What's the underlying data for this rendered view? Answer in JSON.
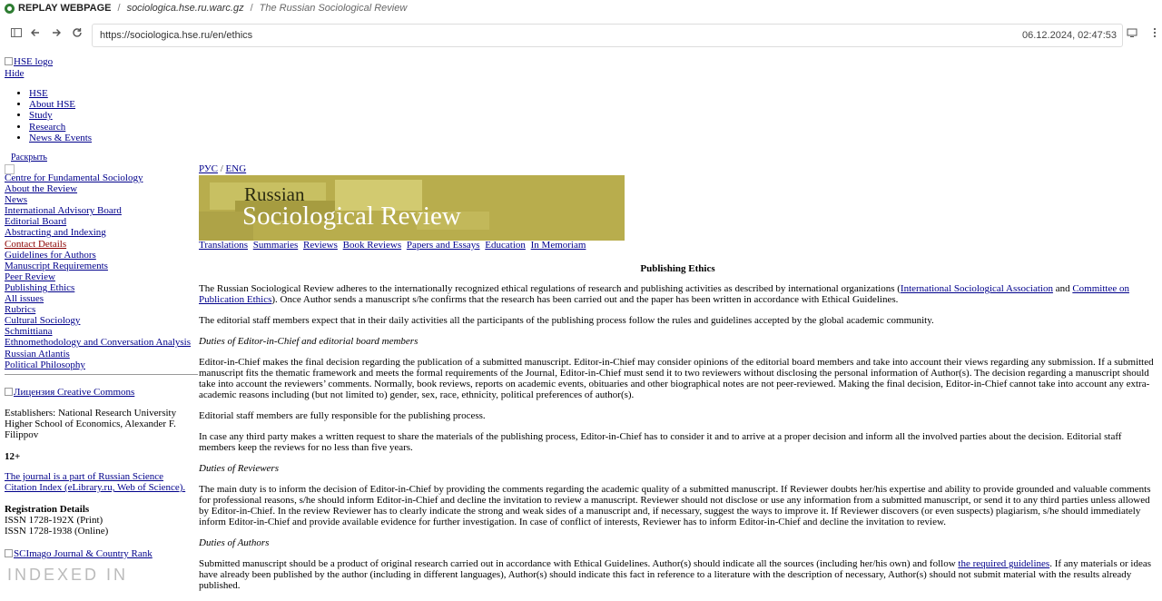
{
  "replay": {
    "brand": "REPLAY WEBPAGE",
    "crumb_site": "sociologica.hse.ru.warc.gz",
    "crumb_title": "The Russian Sociological Review",
    "url": "https://sociologica.hse.ru/en/ethics",
    "timestamp": "06.12.2024, 02:47:53"
  },
  "left": {
    "hse_logo_alt": "HSE logo",
    "hide": "Hide",
    "hse_nav": [
      "HSE",
      "About HSE",
      "Study",
      "Research",
      "News & Events"
    ],
    "expand": "Раскрыть",
    "side_nav": [
      "Centre for Fundamental Sociology",
      "About the Review",
      "News",
      "International Advisory Board",
      "Editorial Board",
      "Abstracting and Indexing",
      "Contact Details",
      "Guidelines for Authors",
      "Manuscript Requirements",
      "Peer Review",
      "Publishing Ethics",
      "All issues",
      "Rubrics",
      "Cultural Sociology",
      "Schmittiana",
      "Ethnomethodology and Conversation Analysis",
      "Russian Atlantis",
      "Political Philosophy"
    ],
    "cc_alt": "Лицензия Creative Commons",
    "establishers": "Establishers: National Research University Higher School of Economics, Alexander F. Filippov",
    "age": "12+",
    "rsci": "The journal is a part of Russian Science Citation Index (eLibrary.ru, Web of Science).",
    "reg_title": "Registration Details",
    "issn_print": "ISSN 1728-192X (Print)",
    "issn_online": "ISSN 1728-1938 (Online)",
    "scimago_alt": "SCImago Journal & Country Rank",
    "indexed": "INDEXED IN"
  },
  "main": {
    "lang_ru": "РУС",
    "lang_sep": "/",
    "lang_en": "ENG",
    "banner_line1": "Russian",
    "banner_line2": "Sociological Review",
    "top_nav": [
      "Translations",
      "Summaries",
      "Reviews",
      "Book Reviews",
      "Papers and Essays",
      "Education",
      "In Memoriam"
    ],
    "heading": "Publishing Ethics",
    "p1_a": "The Russian Sociological Review adheres to the internationally recognized ethical regulations of research and publishing activities as described by international organizations (",
    "p1_link1": "International Sociological Association",
    "p1_b": " and ",
    "p1_link2": "Committee on Publication Ethics",
    "p1_c": "). Once Author sends a manuscript s/he confirms that the research has been carried out and the paper has been written in accordance with Ethical Guidelines.",
    "p2": "The editorial staff members expect that in their daily activities all the participants of the publishing process follow the rules and guidelines accepted by the global academic community.",
    "sub1": "Duties of Editor-in-Chief and editorial board members",
    "p3": "Editor-in-Chief makes the final decision regarding the publication of a submitted manuscript. Editor-in-Chief may consider opinions of the editorial board members and take into account their views regarding any submission. If a submitted manuscript fits the thematic framework and meets the formal requirements of the Journal, Editor-in-Chief must send it to two reviewers without disclosing the personal information of Author(s). The decision regarding a manuscript should take into account the reviewers’ comments. Normally, book reviews, reports on academic events, obituaries and other biographical notes are not peer-reviewed. Making the final decision, Editor-in-Chief cannot take into account any extra-academic reasons including (but not limited to) gender, sex, race, ethnicity, political preferences of author(s).",
    "p4": "Editorial staff members are fully responsible for the publishing process.",
    "p5": "In case any third party makes a written request to share the materials of the publishing process, Editor-in-Chief has to consider it and to arrive at a proper decision and inform all the involved parties about the decision. Editorial staff members keep the reviews for no less than five years.",
    "sub2": "Duties of Reviewers",
    "p6": "The main duty is to inform the decision of Editor-in-Chief by providing the comments regarding the academic quality of a submitted manuscript. If Reviewer doubts her/his expertise and ability to provide grounded and valuable comments for professional reasons, s/he should inform Editor-in-Chief and decline the invitation to review a manuscript. Reviewer should not disclose or use any information from a submitted manuscript, or send it to any third parties unless allowed by Editor-in-Chief. In the review Reviewer has to clearly indicate the strong and weak sides of a manuscript and, if necessary, suggest the ways to improve it. If Reviewer discovers (or even suspects) plagiarism, s/he should immediately inform Editor-in-Chief and provide available evidence for further investigation. In case of conflict of interests, Reviewer has to inform Editor-in-Chief and decline the invitation to review.",
    "sub3": "Duties of Authors",
    "p7_a": "Submitted manuscript should be a product of original research carried out in accordance with Ethical Guidelines. Author(s) should indicate all the sources (including her/his own) and follow ",
    "p7_link": "the required guidelines",
    "p7_b": ". If any materials or ideas have already been published by the author (including in different languages), Author(s) should indicate this fact in reference to a literature with the description of necessary, Author(s) should not submit material with the results already published."
  }
}
